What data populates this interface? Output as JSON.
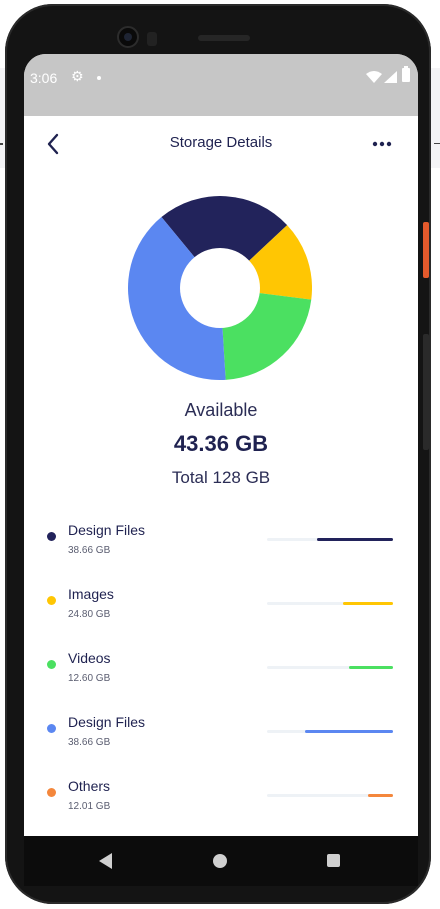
{
  "statusbar": {
    "time": "3:06",
    "icons": [
      "gear-icon",
      "notification-dot-icon",
      "wifi-icon",
      "signal-icon",
      "battery-icon"
    ]
  },
  "header": {
    "title": "Storage Details",
    "back_icon": "chevron-left-icon",
    "more_icon": "more-horizontal-icon"
  },
  "summary": {
    "available_label": "Available",
    "available_value": "43.36 GB",
    "total": "Total 128 GB"
  },
  "chart_data": {
    "type": "pie",
    "hole": true,
    "slices": [
      {
        "category": "Design Files",
        "share": 0.24,
        "color": "#22235b"
      },
      {
        "category": "Images",
        "share": 0.14,
        "color": "#ffc603"
      },
      {
        "category": "Videos",
        "share": 0.22,
        "color": "#4be061"
      },
      {
        "category": "Design Files",
        "share": 0.4,
        "color": "#5b87f1"
      }
    ]
  },
  "storage_items": [
    {
      "name": "Design Files",
      "size": "38.66 GB",
      "color": "#22235b",
      "fill": 0.6
    },
    {
      "name": "Images",
      "size": "24.80 GB",
      "color": "#ffc603",
      "fill": 0.4
    },
    {
      "name": "Videos",
      "size": "12.60 GB",
      "color": "#4be061",
      "fill": 0.35
    },
    {
      "name": "Design Files",
      "size": "38.66 GB",
      "color": "#5b87f1",
      "fill": 0.7
    },
    {
      "name": "Others",
      "size": "12.01 GB",
      "color": "#f4873c",
      "fill": 0.2
    }
  ],
  "navbar": {
    "icons": [
      "nav-back-icon",
      "nav-home-icon",
      "nav-recents-icon"
    ]
  },
  "colors": {
    "text_primary": "#1f2250",
    "statusbar": "#c6c6c6",
    "phone_frame": "#141414"
  }
}
